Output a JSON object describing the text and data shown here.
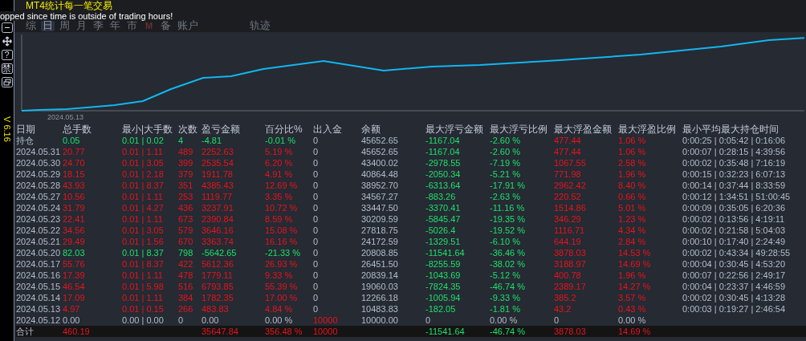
{
  "title": "MT4统计每一笔交易",
  "notice": "opped since time is outside of trading hours!",
  "side_tools": [
    {
      "kind": "minus"
    },
    {
      "kind": "move"
    },
    {
      "kind": "text",
      "label": "?"
    },
    {
      "kind": "text",
      "label": "禁"
    },
    {
      "kind": "restore"
    }
  ],
  "version": "V 6.16",
  "tabs": [
    {
      "label": "综",
      "selected": false
    },
    {
      "label": "日",
      "selected": true
    },
    {
      "label": "周",
      "selected": false
    },
    {
      "label": "月",
      "selected": false
    },
    {
      "label": "季",
      "selected": false
    },
    {
      "label": "年",
      "selected": false
    },
    {
      "label": "市",
      "selected": false
    },
    {
      "label": "M",
      "selected": false,
      "kind": "logo"
    },
    {
      "label": "备",
      "selected": false
    },
    {
      "label": "账户",
      "selected": false
    },
    {
      "label": "轨迹",
      "selected": false,
      "kind": "far"
    }
  ],
  "chart": {
    "date_label": "2024.05.13"
  },
  "table": {
    "columns": [
      "日期",
      "总手数",
      "最小|大手数",
      "次数",
      "盈亏金额",
      "百分比%",
      "出入金",
      "余额",
      "最大浮亏金额",
      "最大浮亏比例",
      "最大浮盈金额",
      "最大浮盈比例",
      "最小平均最大持仓时间"
    ],
    "rows": [
      {
        "kind": "loss",
        "deposit_in": false,
        "date": "持仓",
        "lots": "0.05",
        "range": "0.01 | 0.02",
        "count": "4",
        "pnl": "-4.81",
        "pct": "-0.01 %",
        "deposit": "0",
        "balance": "45652.65",
        "fl_amt": "-1167.04",
        "fl_pct": "-2.60 %",
        "fp_amt": "477.44",
        "fp_pct": "1.06 %",
        "times": "0:00:25 | 0:05:42 | 0:16:06"
      },
      {
        "kind": "profit",
        "deposit_in": false,
        "date": "2024.05.31",
        "lots": "20.77",
        "range": "0.01 | 1.11",
        "count": "489",
        "pnl": "2252.63",
        "pct": "5.19 %",
        "deposit": "0",
        "balance": "45652.65",
        "fl_amt": "-1167.04",
        "fl_pct": "-2.60 %",
        "fp_amt": "477.44",
        "fp_pct": "1.06 %",
        "times": "0:00:07 | 0:28:15 | 4:39:56"
      },
      {
        "kind": "profit",
        "deposit_in": false,
        "date": "2024.05.30",
        "lots": "24.70",
        "range": "0.01 | 3.05",
        "count": "399",
        "pnl": "2535.54",
        "pct": "6.20 %",
        "deposit": "0",
        "balance": "43400.02",
        "fl_amt": "-2978.55",
        "fl_pct": "-7.19 %",
        "fp_amt": "1067.55",
        "fp_pct": "2.58 %",
        "times": "0:00:02 | 0:35:48 | 7:16:19"
      },
      {
        "kind": "profit",
        "deposit_in": false,
        "date": "2024.05.29",
        "lots": "18.15",
        "range": "0.01 | 2.18",
        "count": "379",
        "pnl": "1911.78",
        "pct": "4.91 %",
        "deposit": "0",
        "balance": "40864.48",
        "fl_amt": "-2050.34",
        "fl_pct": "-5.21 %",
        "fp_amt": "771.98",
        "fp_pct": "1.96 %",
        "times": "0:00:15 | 0:32:23 | 6:07:13"
      },
      {
        "kind": "profit",
        "deposit_in": false,
        "date": "2024.05.28",
        "lots": "43.93",
        "range": "0.01 | 8.37",
        "count": "351",
        "pnl": "4385.43",
        "pct": "12.69 %",
        "deposit": "0",
        "balance": "38952.70",
        "fl_amt": "-6313.64",
        "fl_pct": "-17.91 %",
        "fp_amt": "2962.42",
        "fp_pct": "8.40 %",
        "times": "0:00:14 | 0:37:44 | 8:33:59"
      },
      {
        "kind": "profit",
        "deposit_in": false,
        "date": "2024.05.27",
        "lots": "10.56",
        "range": "0.01 | 1.11",
        "count": "253",
        "pnl": "1119.77",
        "pct": "3.35 %",
        "deposit": "0",
        "balance": "34567.27",
        "fl_amt": "-883.26",
        "fl_pct": "-2.63 %",
        "fp_amt": "220.52",
        "fp_pct": "0.66 %",
        "times": "0:00:12 | 1:34:51 | 51:00:45"
      },
      {
        "kind": "profit",
        "deposit_in": false,
        "date": "2024.05.24",
        "lots": "31.79",
        "range": "0.01 | 4.27",
        "count": "436",
        "pnl": "3237.91",
        "pct": "10.72 %",
        "deposit": "0",
        "balance": "33447.50",
        "fl_amt": "-3370.41",
        "fl_pct": "-11.16 %",
        "fp_amt": "1514.86",
        "fp_pct": "5.01 %",
        "times": "0:00:09 | 0:35:05 | 6:20:36"
      },
      {
        "kind": "profit",
        "deposit_in": false,
        "date": "2024.05.23",
        "lots": "22.41",
        "range": "0.01 | 1.11",
        "count": "673",
        "pnl": "2390.84",
        "pct": "8.59 %",
        "deposit": "0",
        "balance": "30209.59",
        "fl_amt": "-5845.47",
        "fl_pct": "-19.35 %",
        "fp_amt": "346.29",
        "fp_pct": "1.23 %",
        "times": "0:00:02 | 0:13:56 | 4:19:11"
      },
      {
        "kind": "profit",
        "deposit_in": false,
        "date": "2024.05.22",
        "lots": "34.56",
        "range": "0.01 | 3.05",
        "count": "579",
        "pnl": "3646.16",
        "pct": "15.08 %",
        "deposit": "0",
        "balance": "27818.75",
        "fl_amt": "-5026.4",
        "fl_pct": "-19.52 %",
        "fp_amt": "1116.71",
        "fp_pct": "4.34 %",
        "times": "0:00:02 | 0:21:58 | 5:04:03"
      },
      {
        "kind": "profit",
        "deposit_in": false,
        "date": "2024.05.21",
        "lots": "29.49",
        "range": "0.01 | 1.56",
        "count": "670",
        "pnl": "3363.74",
        "pct": "16.16 %",
        "deposit": "0",
        "balance": "24172.59",
        "fl_amt": "-1329.51",
        "fl_pct": "-6.10 %",
        "fp_amt": "644.19",
        "fp_pct": "2.84 %",
        "times": "0:00:10 | 0:17:40 | 2:24:49"
      },
      {
        "kind": "loss",
        "deposit_in": false,
        "date": "2024.05.20",
        "lots": "82.03",
        "range": "0.01 | 8.37",
        "count": "798",
        "pnl": "-5642.65",
        "pct": "-21.33 %",
        "deposit": "0",
        "balance": "20808.85",
        "fl_amt": "-11541.64",
        "fl_pct": "-36.46 %",
        "fp_amt": "3878.03",
        "fp_pct": "14.53 %",
        "times": "0:00:02 | 0:43:34 | 49:28:55"
      },
      {
        "kind": "profit",
        "deposit_in": false,
        "date": "2024.05.17",
        "lots": "55.76",
        "range": "0.01 | 8.37",
        "count": "422",
        "pnl": "5612.36",
        "pct": "26.93 %",
        "deposit": "0",
        "balance": "26451.50",
        "fl_amt": "-8255.59",
        "fl_pct": "-38.02 %",
        "fp_amt": "3188.97",
        "fp_pct": "14.69 %",
        "times": "0:00:04 | 0:30:45 | 4:53:20"
      },
      {
        "kind": "profit",
        "deposit_in": false,
        "date": "2024.05.16",
        "lots": "17.39",
        "range": "0.01 | 1.11",
        "count": "478",
        "pnl": "1779.11",
        "pct": "9.33 %",
        "deposit": "0",
        "balance": "20839.14",
        "fl_amt": "-1043.69",
        "fl_pct": "-5.12 %",
        "fp_amt": "400.78",
        "fp_pct": "1.96 %",
        "times": "0:00:07 | 0:22:56 | 2:49:17"
      },
      {
        "kind": "profit",
        "deposit_in": false,
        "date": "2024.05.15",
        "lots": "46.54",
        "range": "0.01 | 5.98",
        "count": "516",
        "pnl": "6793.85",
        "pct": "55.39 %",
        "deposit": "0",
        "balance": "19060.03",
        "fl_amt": "-7824.35",
        "fl_pct": "-46.74 %",
        "fp_amt": "2389.17",
        "fp_pct": "14.27 %",
        "times": "0:00:04 | 0:23:37 | 4:46:59"
      },
      {
        "kind": "profit",
        "deposit_in": false,
        "date": "2024.05.14",
        "lots": "17.09",
        "range": "0.01 | 1.11",
        "count": "384",
        "pnl": "1782.35",
        "pct": "17.00 %",
        "deposit": "0",
        "balance": "12266.18",
        "fl_amt": "-1005.94",
        "fl_pct": "-9.33 %",
        "fp_amt": "385.2",
        "fp_pct": "3.57 %",
        "times": "0:00:02 | 0:30:45 | 4:13:28"
      },
      {
        "kind": "profit",
        "deposit_in": false,
        "date": "2024.05.13",
        "lots": "4.97",
        "range": "0.01 | 0.15",
        "count": "266",
        "pnl": "483.83",
        "pct": "4.84 %",
        "deposit": "0",
        "balance": "10483.83",
        "fl_amt": "-182.05",
        "fl_pct": "-1.81 %",
        "fp_amt": "43.2",
        "fp_pct": "0.43 %",
        "times": "0:00:03 | 0:19:27 | 2:46:54"
      },
      {
        "kind": "flat",
        "deposit_in": true,
        "date": "2024.05.12",
        "lots": "0.00",
        "range": "0.00 | 0.00",
        "count": "0",
        "pnl": "0.00",
        "pct": "0.00 %",
        "deposit": "10000",
        "balance": "10000.00",
        "fl_amt": "0",
        "fl_pct": "0.00 %",
        "fp_amt": "0",
        "fp_pct": "0.00 %"
      }
    ],
    "total": {
      "kind": "profit",
      "deposit_in": true,
      "date": "合计",
      "lots": "460.19",
      "pnl": "35647.84",
      "pct": "356.48 %",
      "deposit": "10000",
      "fl_amt": "-11541.64",
      "fl_pct": "-46.74 %",
      "fp_amt": "3878.03",
      "fp_pct": "14.69 %"
    }
  }
}
